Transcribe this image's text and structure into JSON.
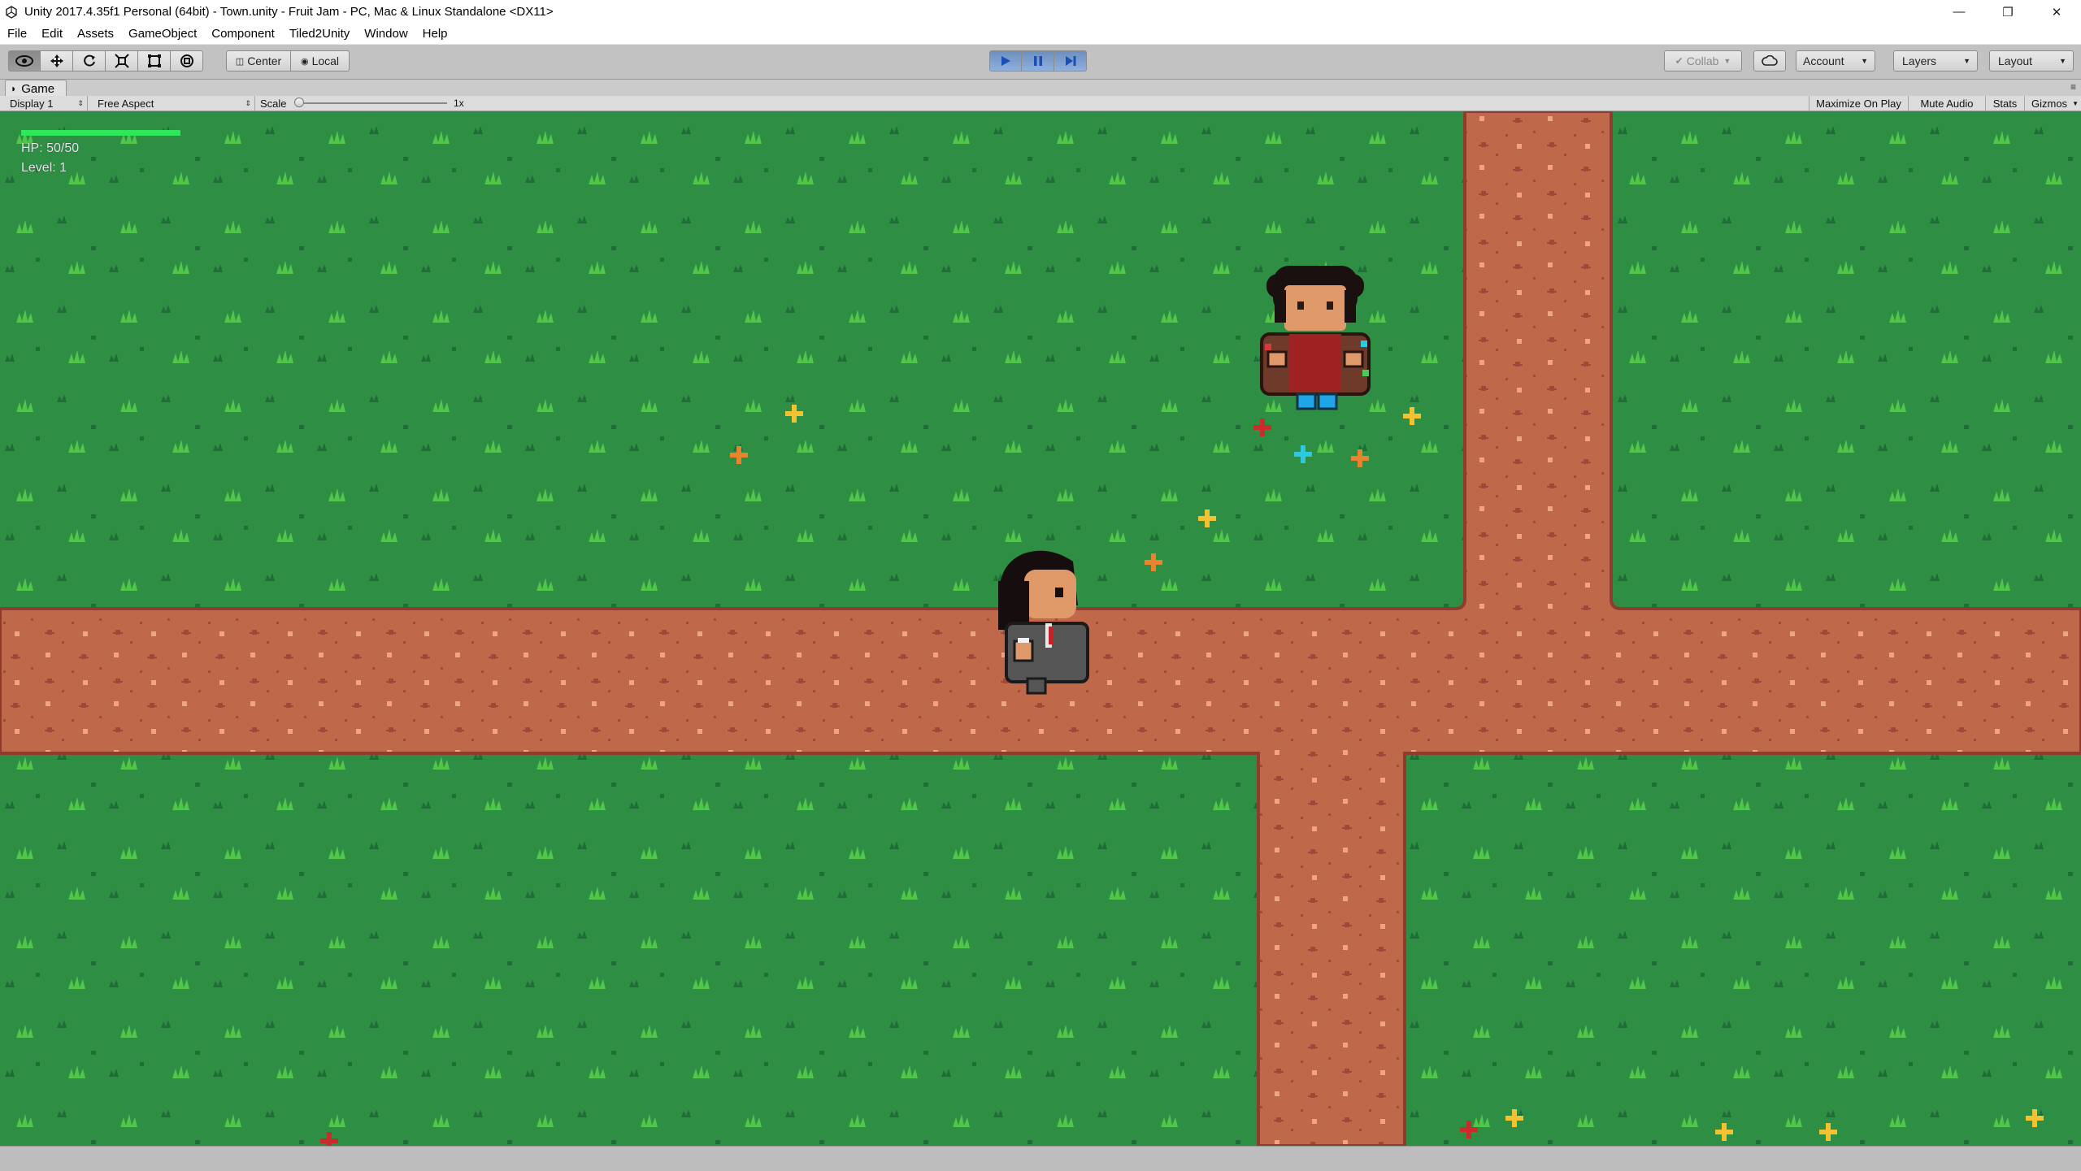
{
  "window": {
    "title": "Unity 2017.4.35f1 Personal (64bit) - Town.unity - Fruit Jam - PC, Mac & Linux Standalone <DX11>",
    "controls": [
      "minimize-icon",
      "restore-icon",
      "close-icon"
    ]
  },
  "menu": [
    "File",
    "Edit",
    "Assets",
    "GameObject",
    "Component",
    "Tiled2Unity",
    "Window",
    "Help"
  ],
  "toolbar": {
    "tools": [
      "view-eye-icon",
      "move-icon",
      "rotate-icon",
      "scale-icon",
      "rect-tool-icon",
      "transform-tool-icon"
    ],
    "pivot_label": "Center",
    "handle_label": "Local",
    "play_state": "playing",
    "collab_label": "Collab",
    "account_label": "Account",
    "layers_label": "Layers",
    "layout_label": "Layout"
  },
  "game_panel": {
    "tab_label": "Game",
    "display_label": "Display 1",
    "aspect_label": "Free Aspect",
    "scale_label": "Scale",
    "scale_value_label": "1x",
    "scale_value": 1,
    "toggles": [
      "Maximize On Play",
      "Mute Audio",
      "Stats",
      "Gizmos"
    ]
  },
  "hud": {
    "hp_text": "HP: 50/50",
    "level_text": "Level: 1",
    "hp_fraction": 1.0
  },
  "colors": {
    "grass": "#2e8f44",
    "path": "#c0684a",
    "hp_bar": "#2ee85a",
    "play_active": "#6d8fbf"
  }
}
